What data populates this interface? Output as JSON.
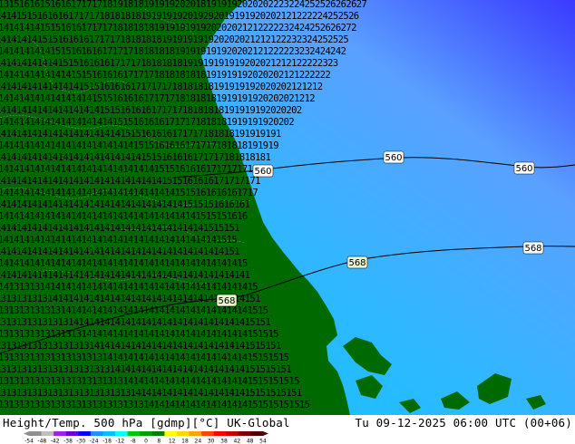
{
  "footer": {
    "title_left": "Height/Temp. 500 hPa [gdmp][°C] UK-Global",
    "title_right": "Tu 09-12-2025 06:00 UTC (00+06)"
  },
  "colorbar": {
    "ticks": [
      "-54",
      "-48",
      "-42",
      "-38",
      "-30",
      "-24",
      "-18",
      "-12",
      "-8",
      "0",
      "8",
      "12",
      "18",
      "24",
      "30",
      "38",
      "42",
      "48",
      "54"
    ],
    "colors": [
      "#8e8e8e",
      "#bfbfbf",
      "#a020f0",
      "#6a00d8",
      "#0000ff",
      "#1e90ff",
      "#00bfff",
      "#00ffff",
      "#00c800",
      "#00a000",
      "#008000",
      "#ffff00",
      "#ffd700",
      "#ffa500",
      "#ff4500",
      "#ff0000",
      "#c80000",
      "#800000",
      "#500000"
    ]
  },
  "map": {
    "colors": {
      "land": "#006a00",
      "sea_cold": "#00c8ff",
      "sea_mid": "#3fb0ff",
      "sea_warm": "#6a8bff",
      "far_north": "#3a3aff"
    },
    "contour_labels": [
      "560",
      "560",
      "560",
      "568",
      "568",
      "568"
    ],
    "temperature_rows": [
      "13151616151616171717181918181919192020181919192020202223224252526262627",
      "1414151516161617171718181818191919192019292019191920202121222224252526",
      "141414141515161617171718181818191919191920202021212222232424252626272",
      "14141414151516161617171718181818191919191920202021212122232324252525",
      "1414141414151516161617171718181818191919191920202121222223232424242",
      "141414141414151516161617171718181818191919191919202021212122222323",
      "1414141414141415151616161717171818181818191919192020202121222222",
      "141414141414141415151616161717171718181818191919192020202121212",
      "1414141414141414141515161616171717181818181919191920202021212",
      "14141414141414141414151516161617171718181818191919192020202",
      "141414141414141414141415151616161717171818181919191920202",
      "1414141414141414141414141515161616171717181818191919191",
      "141414141414141414141414141515161616171717181818191919",
      "14141414141414141414141414141515161616171717181818181",
      "1414141414141414141414141414141515161616171717171818",
      "141414141414141414141414141414141515161616171717171",
      "14141414141414141414141414141414141515161616161717",
      "1414141414141414141414141414141414141515151616161",
      "141414141414141414141414141414141414141515151616",
      "14141414141414141414141414141414141414141515151",
      "1414141414141414141414141414141414141414141515",
      "14141414141414141414141414141414141414141414151",
      "141414141414141414141414141414141414141414141415",
      "1414141414141414141414141414141414141414141414141",
      "14131313141414141414141414141414141414141414141415",
      "131313131314141414141414141414141414141414141414151",
      "1313131313131414141414141414141414141414141414141515",
      "13131313131313141414141414141414141414141414141415151",
      "131313131313131314141414141414141414141414141414151515",
      "1313131313131313131414141414141414141414141414141515151",
      "13131313131313131313141414141414141414141414141415151515",
      "131313131313131313131314141414141414141414141414151515151",
      "1313131313131313131313131414141414141414141414141515151515",
      "13131313131313131313131313141414141414141414141415151515151",
      "131313131313131313131313131314141414141414141414151515151515"
    ]
  }
}
